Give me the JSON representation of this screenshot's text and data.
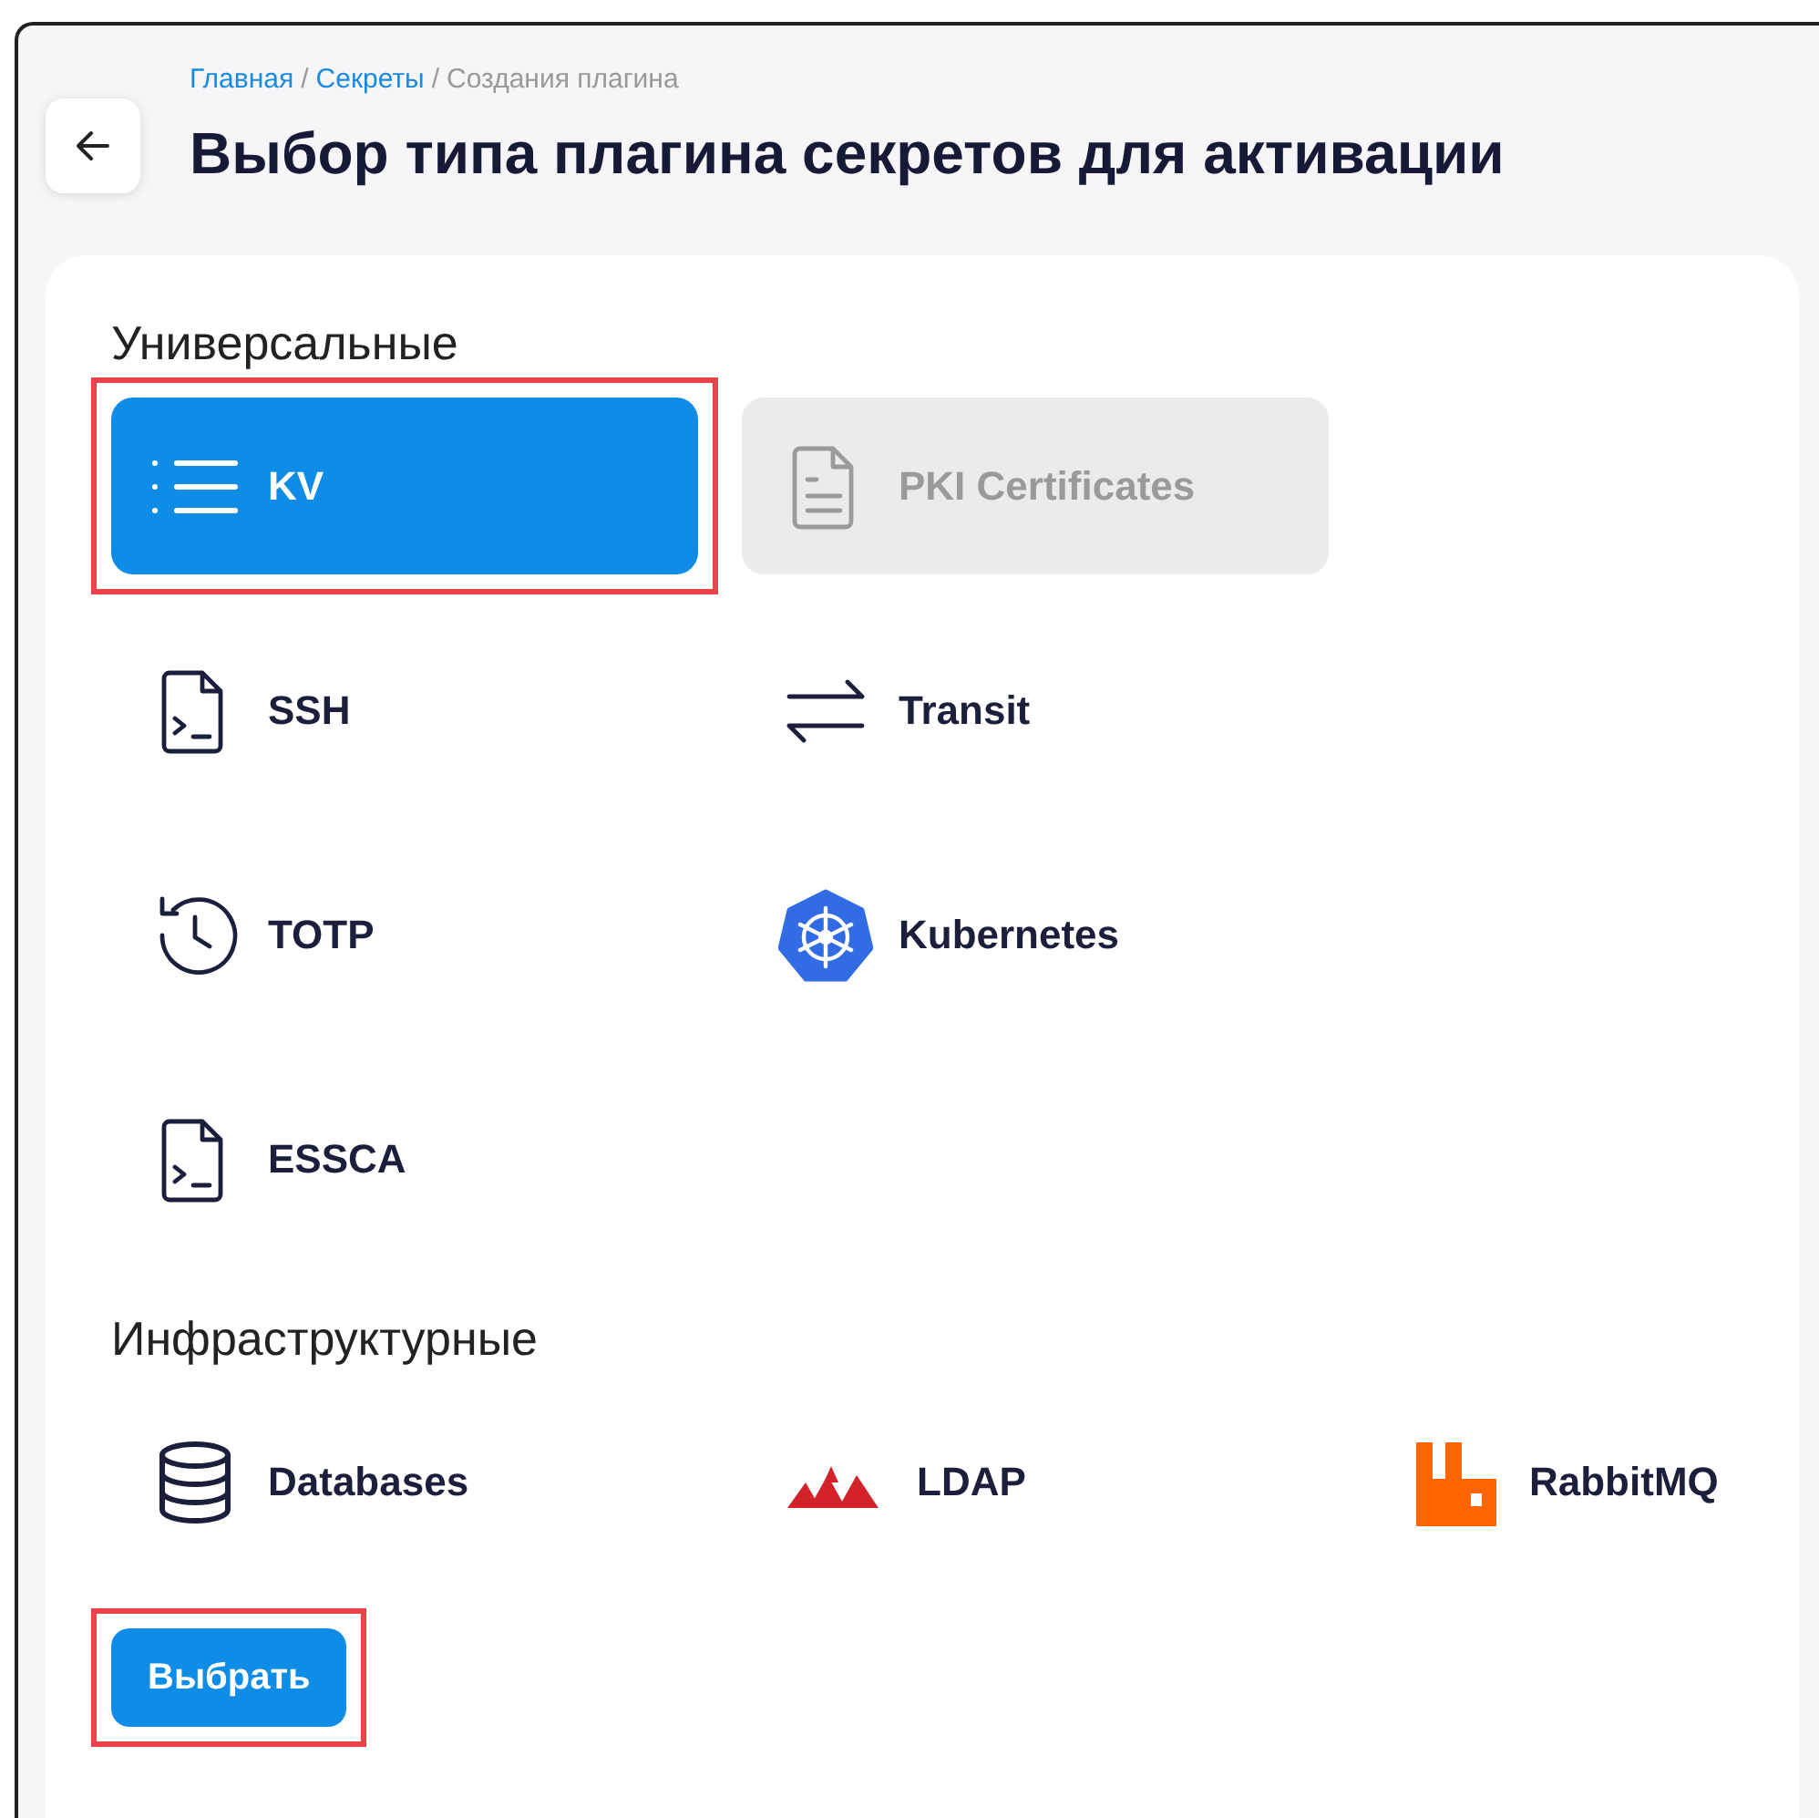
{
  "breadcrumb": [
    {
      "label": "Главная",
      "link": true
    },
    {
      "separator": "/",
      "label": "Секреты",
      "link": true
    },
    {
      "separator": "/",
      "label": "Создания плагина",
      "link": false
    }
  ],
  "title": "Выбор типа плагина секретов для активации",
  "sections": [
    {
      "heading": "Универсальные",
      "items": [
        {
          "label": "KV",
          "kind": "list",
          "selected": true,
          "disabled": false,
          "highlighted": true
        },
        {
          "label": "PKI Certificates",
          "kind": "document",
          "selected": false,
          "disabled": true,
          "highlighted": false
        },
        {
          "label": "SSH",
          "kind": "terminal",
          "selected": false,
          "disabled": false,
          "highlighted": false
        },
        {
          "label": "Transit",
          "kind": "arrows",
          "selected": false,
          "disabled": false,
          "highlighted": false
        },
        {
          "label": "TOTP",
          "kind": "history",
          "selected": false,
          "disabled": false,
          "highlighted": false
        },
        {
          "label": "Kubernetes",
          "kind": "helm",
          "selected": false,
          "disabled": false,
          "highlighted": false
        },
        {
          "label": "ESSCA",
          "kind": "terminal",
          "selected": false,
          "disabled": false,
          "highlighted": false
        }
      ]
    },
    {
      "heading": "Инфраструктурные",
      "items": [
        {
          "label": "Databases",
          "kind": "database",
          "selected": false,
          "disabled": false,
          "highlighted": false
        },
        {
          "label": "LDAP",
          "kind": "peaks",
          "selected": false,
          "disabled": false,
          "highlighted": false
        },
        {
          "label": "RabbitMQ",
          "kind": "rabbit",
          "selected": false,
          "disabled": false,
          "highlighted": false
        }
      ]
    }
  ],
  "button": {
    "label": "Выбрать",
    "highlighted": true
  }
}
